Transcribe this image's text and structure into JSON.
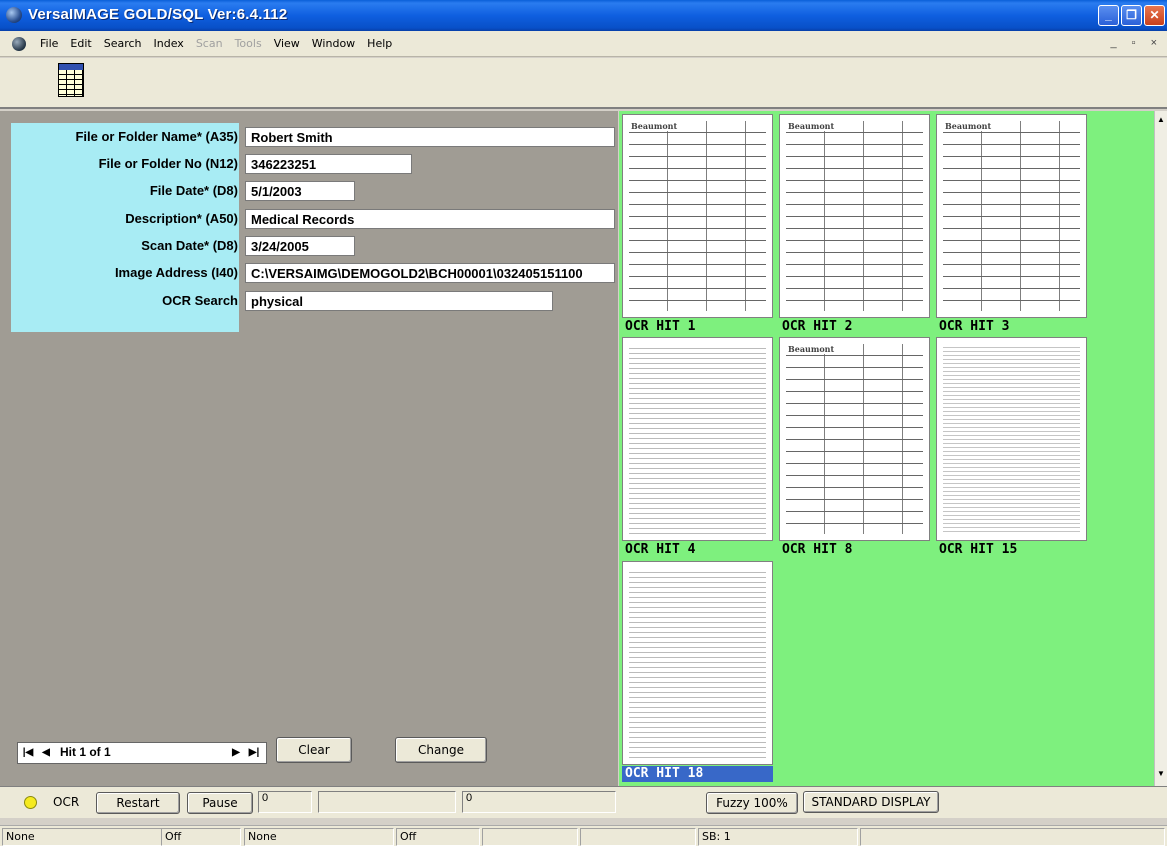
{
  "window": {
    "title": "VersaIMAGE GOLD/SQL Ver:6.4.112",
    "app_icon": "versaimage-app-icon",
    "caption_buttons": [
      "minimize",
      "restore",
      "close"
    ]
  },
  "menu": {
    "items": [
      {
        "label": "File",
        "enabled": true
      },
      {
        "label": "Edit",
        "enabled": true
      },
      {
        "label": "Search",
        "enabled": true
      },
      {
        "label": "Index",
        "enabled": true
      },
      {
        "label": "Scan",
        "enabled": false
      },
      {
        "label": "Tools",
        "enabled": false
      },
      {
        "label": "View",
        "enabled": true
      },
      {
        "label": "Window",
        "enabled": true
      },
      {
        "label": "Help",
        "enabled": true
      }
    ],
    "mdi_controls": "_ ▫ ×"
  },
  "toolbar": {
    "grid_icon": "table-grid-icon"
  },
  "form": {
    "fields": [
      {
        "label": "File or Folder Name* (A35)",
        "value": "Robert Smith"
      },
      {
        "label": "File or Folder No (N12)",
        "value": "346223251"
      },
      {
        "label": "File Date* (D8)",
        "value": "5/1/2003"
      },
      {
        "label": "Description* (A50)",
        "value": "Medical Records"
      },
      {
        "label": "Scan Date* (D8)",
        "value": "3/24/2005"
      },
      {
        "label": "Image Address (I40)",
        "value": "C:\\VERSAIMG\\DEMOGOLD2\\BCH00001\\032405151100"
      },
      {
        "label": "OCR Search",
        "value": "physical"
      }
    ]
  },
  "navigator": {
    "text": "Hit 1 of 1",
    "first": "|◀",
    "prev": "◀",
    "next": "▶",
    "last": "▶|"
  },
  "buttons": {
    "clear": "Clear",
    "change": "Change",
    "restart": "Restart",
    "pause": "Pause",
    "fuzzy": "Fuzzy 100%",
    "standard_display": "STANDARD DISPLAY"
  },
  "thumbnails": [
    {
      "caption": "OCR HIT 1",
      "selected": false
    },
    {
      "caption": "OCR HIT 2",
      "selected": false
    },
    {
      "caption": "OCR HIT 3",
      "selected": false
    },
    {
      "caption": "OCR HIT 4",
      "selected": false
    },
    {
      "caption": "OCR HIT 8",
      "selected": false
    },
    {
      "caption": "OCR HIT 15",
      "selected": false
    },
    {
      "caption": "OCR HIT 18",
      "selected": true
    }
  ],
  "thumbnail_logo": "Beaumont",
  "ocr_bar": {
    "label": "OCR",
    "counter1": "0",
    "counter2": "",
    "counter3": "0"
  },
  "status": {
    "cells": [
      "None",
      "Off",
      "None",
      "Off",
      "",
      "",
      "SB: 1",
      ""
    ]
  },
  "colors": {
    "label_bg": "#a8ecf4",
    "form_bg": "#a09c94",
    "thumb_bg": "#7ef07e",
    "selected_caption": "#3868c8"
  }
}
